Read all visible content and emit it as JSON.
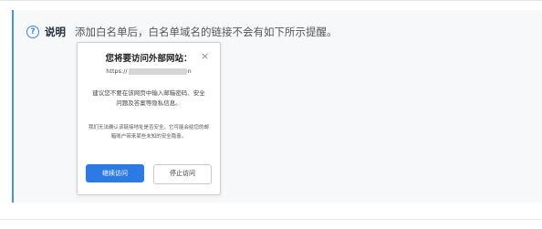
{
  "note": {
    "title": "说明",
    "text": "添加白名单后，白名单域名的链接不会有如下所示提醒。"
  },
  "dialog": {
    "title": "您将要访问外部网站：",
    "close_glyph": "×",
    "url_prefix": "https://",
    "url_suffix": "n",
    "message_primary": "建议您不要在该网页中输入邮箱密码、安全问题及答案等隐私信息。",
    "message_secondary": "我们无法确认该链接地址是否安全，它可能会给您的邮箱账户带来某些未知的安全隐患。",
    "continue_label": "继续访问",
    "stop_label": "停止访问"
  },
  "icons": {
    "info": "question-circle-icon"
  },
  "colors": {
    "accent": "#2c7be5",
    "panel_bg": "#f7f8fa",
    "panel_border": "#4a90e2"
  }
}
